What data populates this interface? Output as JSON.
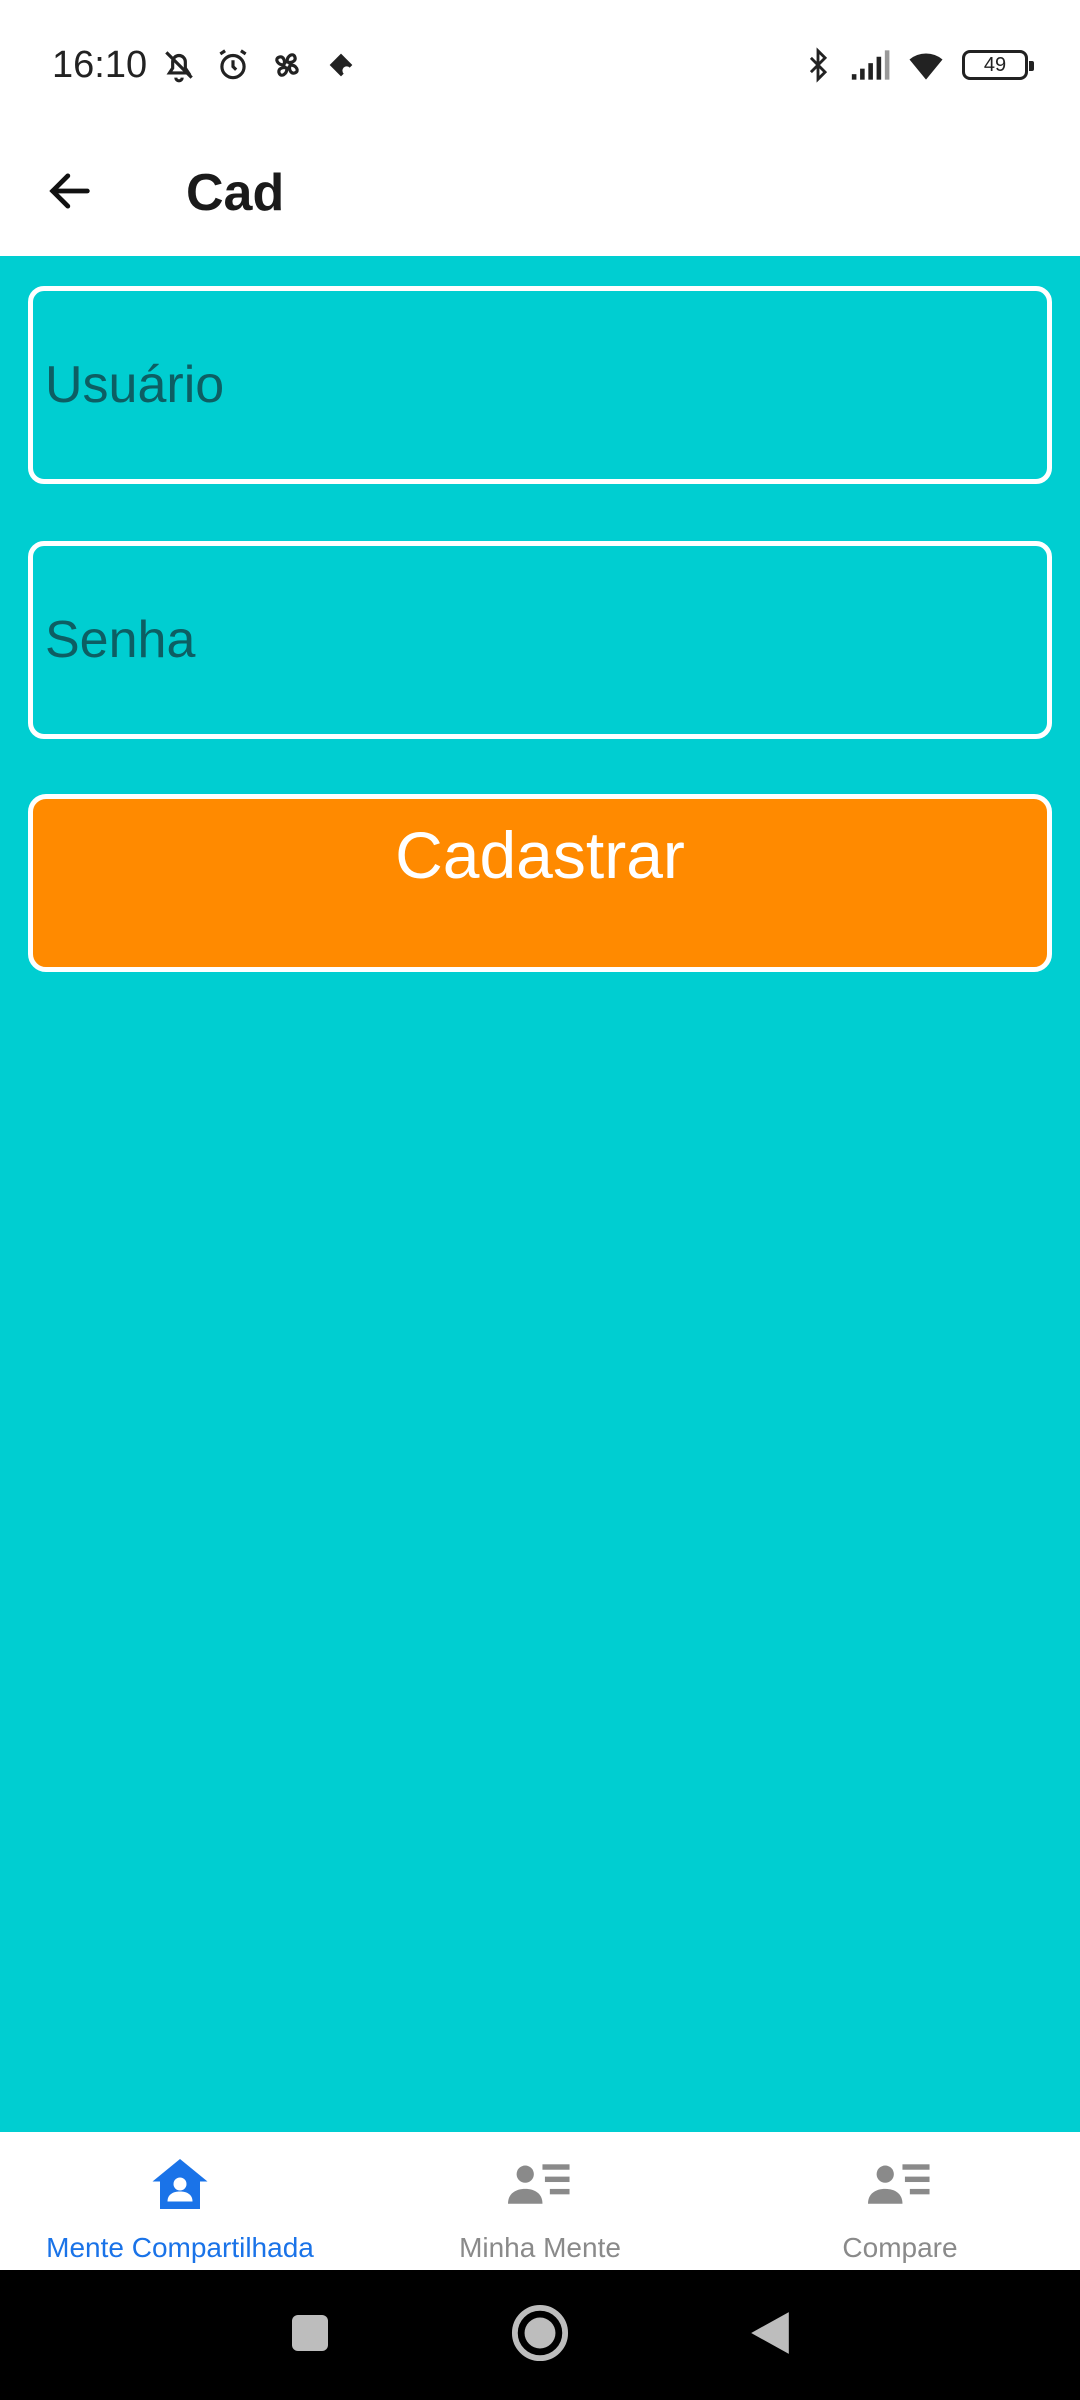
{
  "status_bar": {
    "time": "16:10",
    "battery": "49",
    "left_icons": [
      "muted-bell-icon",
      "alarm-icon",
      "fan-icon",
      "app-notification-icon"
    ],
    "right_icons": [
      "bluetooth-icon",
      "signal-icon",
      "wifi-icon",
      "battery-icon"
    ]
  },
  "app_bar": {
    "title": "Cad",
    "back_icon": "arrow-left-icon"
  },
  "form": {
    "username_placeholder": "Usuário",
    "username_value": "",
    "password_placeholder": "Senha",
    "password_value": "",
    "submit_label": "Cadastrar"
  },
  "bottom_nav": {
    "items": [
      {
        "label": "Mente Compartilhada",
        "icon": "home-person-icon",
        "active": true
      },
      {
        "label": "Minha Mente",
        "icon": "person-list-icon",
        "active": false
      },
      {
        "label": "Compare",
        "icon": "person-list-icon",
        "active": false
      }
    ]
  },
  "colors": {
    "background": "#00ced1",
    "button": "#ff8a00",
    "active_nav": "#1a73e8",
    "inactive_nav": "#8a8a8a"
  }
}
